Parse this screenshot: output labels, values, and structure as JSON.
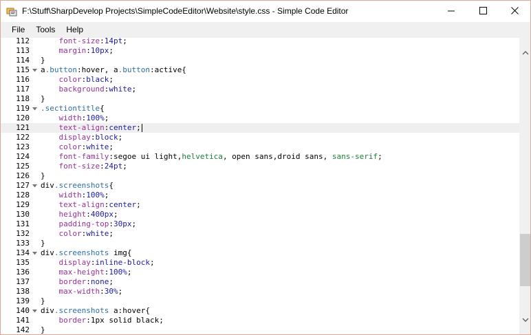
{
  "window": {
    "title": "F:\\Stuff\\SharpDevelop Projects\\SimpleCodeEditor\\Website\\style.css - Simple Code Editor",
    "controls": {
      "minimize": "minimize-icon",
      "maximize": "maximize-icon",
      "close": "close-icon"
    }
  },
  "menu": [
    {
      "label": "File"
    },
    {
      "label": "Tools"
    },
    {
      "label": "Help"
    }
  ],
  "editor": {
    "current_line": 121,
    "scroll_position": 0.87,
    "lines": [
      {
        "n": "112",
        "fold": false,
        "tokens": [
          [
            "    ",
            "plain"
          ],
          [
            "font-size",
            "prop"
          ],
          [
            ":",
            "plain"
          ],
          [
            "14pt",
            "val"
          ],
          [
            ";",
            "plain"
          ]
        ]
      },
      {
        "n": "113",
        "fold": false,
        "tokens": [
          [
            "    ",
            "plain"
          ],
          [
            "margin",
            "prop"
          ],
          [
            ":",
            "plain"
          ],
          [
            "10px",
            "val"
          ],
          [
            ";",
            "plain"
          ]
        ]
      },
      {
        "n": "114",
        "fold": false,
        "tokens": [
          [
            "}",
            "plain"
          ]
        ]
      },
      {
        "n": "115",
        "fold": true,
        "tokens": [
          [
            "a",
            "sel"
          ],
          [
            ".button",
            "cls"
          ],
          [
            ":hover, ",
            "plain"
          ],
          [
            "a",
            "sel"
          ],
          [
            ".button",
            "cls"
          ],
          [
            ":active{",
            "plain"
          ]
        ]
      },
      {
        "n": "116",
        "fold": false,
        "tokens": [
          [
            "    ",
            "plain"
          ],
          [
            "color",
            "prop"
          ],
          [
            ":",
            "plain"
          ],
          [
            "black",
            "val"
          ],
          [
            ";",
            "plain"
          ]
        ]
      },
      {
        "n": "117",
        "fold": false,
        "tokens": [
          [
            "    ",
            "plain"
          ],
          [
            "background",
            "prop"
          ],
          [
            ":",
            "plain"
          ],
          [
            "white",
            "val"
          ],
          [
            ";",
            "plain"
          ]
        ]
      },
      {
        "n": "118",
        "fold": false,
        "tokens": [
          [
            "}",
            "plain"
          ]
        ]
      },
      {
        "n": "119",
        "fold": true,
        "tokens": [
          [
            ".sectiontitle",
            "cls"
          ],
          [
            "{",
            "plain"
          ]
        ]
      },
      {
        "n": "120",
        "fold": false,
        "tokens": [
          [
            "    ",
            "plain"
          ],
          [
            "width",
            "prop"
          ],
          [
            ":",
            "plain"
          ],
          [
            "100%",
            "val"
          ],
          [
            ";",
            "plain"
          ]
        ]
      },
      {
        "n": "121",
        "fold": false,
        "tokens": [
          [
            "    ",
            "plain"
          ],
          [
            "text-align",
            "prop"
          ],
          [
            ":",
            "plain"
          ],
          [
            "center",
            "val"
          ],
          [
            ";",
            "plain"
          ]
        ],
        "caret": true
      },
      {
        "n": "122",
        "fold": false,
        "tokens": [
          [
            "    ",
            "plain"
          ],
          [
            "display",
            "prop"
          ],
          [
            ":",
            "plain"
          ],
          [
            "block",
            "val"
          ],
          [
            ";",
            "plain"
          ]
        ]
      },
      {
        "n": "123",
        "fold": false,
        "tokens": [
          [
            "    ",
            "plain"
          ],
          [
            "color",
            "prop"
          ],
          [
            ":",
            "plain"
          ],
          [
            "white",
            "val"
          ],
          [
            ";",
            "plain"
          ]
        ]
      },
      {
        "n": "124",
        "fold": false,
        "tokens": [
          [
            "    ",
            "plain"
          ],
          [
            "font-family",
            "prop"
          ],
          [
            ":segoe ui light,",
            "plain"
          ],
          [
            "helvetica",
            "kw"
          ],
          [
            ", open sans,droid sans, ",
            "plain"
          ],
          [
            "sans-serif",
            "kw"
          ],
          [
            ";",
            "plain"
          ]
        ]
      },
      {
        "n": "125",
        "fold": false,
        "tokens": [
          [
            "    ",
            "plain"
          ],
          [
            "font-size",
            "prop"
          ],
          [
            ":",
            "plain"
          ],
          [
            "24pt",
            "val"
          ],
          [
            ";",
            "plain"
          ]
        ]
      },
      {
        "n": "126",
        "fold": false,
        "tokens": [
          [
            "}",
            "plain"
          ]
        ]
      },
      {
        "n": "127",
        "fold": true,
        "tokens": [
          [
            "div",
            "sel"
          ],
          [
            ".screenshots",
            "cls"
          ],
          [
            "{",
            "plain"
          ]
        ]
      },
      {
        "n": "128",
        "fold": false,
        "tokens": [
          [
            "    ",
            "plain"
          ],
          [
            "width",
            "prop"
          ],
          [
            ":",
            "plain"
          ],
          [
            "100%",
            "val"
          ],
          [
            ";",
            "plain"
          ]
        ]
      },
      {
        "n": "129",
        "fold": false,
        "tokens": [
          [
            "    ",
            "plain"
          ],
          [
            "text-align",
            "prop"
          ],
          [
            ":",
            "plain"
          ],
          [
            "center",
            "val"
          ],
          [
            ";",
            "plain"
          ]
        ]
      },
      {
        "n": "130",
        "fold": false,
        "tokens": [
          [
            "    ",
            "plain"
          ],
          [
            "height",
            "prop"
          ],
          [
            ":",
            "plain"
          ],
          [
            "400px",
            "val"
          ],
          [
            ";",
            "plain"
          ]
        ]
      },
      {
        "n": "131",
        "fold": false,
        "tokens": [
          [
            "    ",
            "plain"
          ],
          [
            "padding-top",
            "prop"
          ],
          [
            ":",
            "plain"
          ],
          [
            "30px",
            "val"
          ],
          [
            ";",
            "plain"
          ]
        ]
      },
      {
        "n": "132",
        "fold": false,
        "tokens": [
          [
            "    ",
            "plain"
          ],
          [
            "color",
            "prop"
          ],
          [
            ":",
            "plain"
          ],
          [
            "white",
            "val"
          ],
          [
            ";",
            "plain"
          ]
        ]
      },
      {
        "n": "133",
        "fold": false,
        "tokens": [
          [
            "}",
            "plain"
          ]
        ]
      },
      {
        "n": "134",
        "fold": true,
        "tokens": [
          [
            "div",
            "sel"
          ],
          [
            ".screenshots",
            "cls"
          ],
          [
            " img{",
            "plain"
          ]
        ]
      },
      {
        "n": "135",
        "fold": false,
        "tokens": [
          [
            "    ",
            "plain"
          ],
          [
            "display",
            "prop"
          ],
          [
            ":",
            "plain"
          ],
          [
            "inline-block",
            "val"
          ],
          [
            ";",
            "plain"
          ]
        ]
      },
      {
        "n": "136",
        "fold": false,
        "tokens": [
          [
            "    ",
            "plain"
          ],
          [
            "max-height",
            "prop"
          ],
          [
            ":",
            "plain"
          ],
          [
            "100%",
            "val"
          ],
          [
            ";",
            "plain"
          ]
        ]
      },
      {
        "n": "137",
        "fold": false,
        "tokens": [
          [
            "    ",
            "plain"
          ],
          [
            "border",
            "prop"
          ],
          [
            ":",
            "plain"
          ],
          [
            "none",
            "val"
          ],
          [
            ";",
            "plain"
          ]
        ]
      },
      {
        "n": "138",
        "fold": false,
        "tokens": [
          [
            "    ",
            "plain"
          ],
          [
            "max-width",
            "prop"
          ],
          [
            ":",
            "plain"
          ],
          [
            "30%",
            "val"
          ],
          [
            ";",
            "plain"
          ]
        ]
      },
      {
        "n": "139",
        "fold": false,
        "tokens": [
          [
            "}",
            "plain"
          ]
        ]
      },
      {
        "n": "140",
        "fold": true,
        "tokens": [
          [
            "div",
            "sel"
          ],
          [
            ".screenshots",
            "cls"
          ],
          [
            " a:hover{",
            "plain"
          ]
        ]
      },
      {
        "n": "141",
        "fold": false,
        "tokens": [
          [
            "    ",
            "plain"
          ],
          [
            "border",
            "prop"
          ],
          [
            ":1px solid black;",
            "plain"
          ]
        ]
      },
      {
        "n": "142",
        "fold": false,
        "tokens": [
          [
            "}",
            "plain"
          ]
        ]
      }
    ]
  },
  "colors": {
    "selector": "#000000",
    "class": "#2b6fa8",
    "property": "#9b2f9b",
    "value": "#1a1aa6",
    "keyword": "#1a7f3a",
    "current_line_bg": "#efefef",
    "menu_bg": "#f0f0f0",
    "window_border": "#d6a99a"
  }
}
